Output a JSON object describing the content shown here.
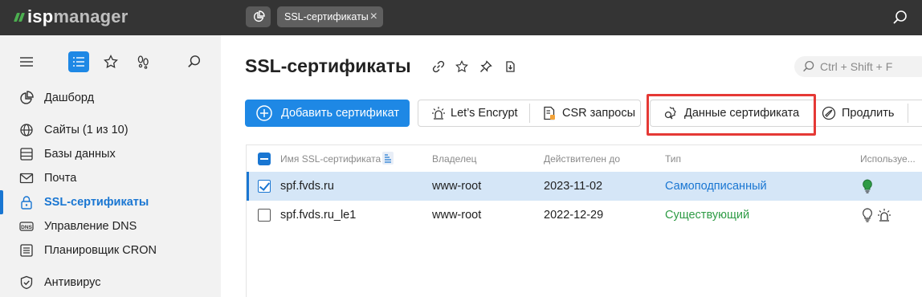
{
  "app": {
    "logo_text_main": "isp",
    "logo_text_rest": "manager"
  },
  "top_tab": {
    "label": "SSL-сертификаты",
    "close": "×"
  },
  "sidebar": {
    "items": [
      {
        "label": "Дашборд",
        "icon": "pie-chart-icon"
      },
      {
        "label": "Сайты (1 из 10)",
        "icon": "globe-icon"
      },
      {
        "label": "Базы данных",
        "icon": "database-icon"
      },
      {
        "label": "Почта",
        "icon": "mail-icon"
      },
      {
        "label": "SSL-сертификаты",
        "icon": "lock-icon",
        "active": true
      },
      {
        "label": "Управление DNS",
        "icon": "dns-icon"
      },
      {
        "label": "Планировщик CRON",
        "icon": "list-icon"
      },
      {
        "label": "Антивирус",
        "icon": "shield-icon"
      }
    ]
  },
  "page": {
    "title": "SSL-сертификаты",
    "search_placeholder": "Ctrl + Shift + F"
  },
  "toolbar": {
    "add": "Добавить сертификат",
    "letsencrypt": "Let’s Encrypt",
    "csr": "CSR запросы",
    "cert_data": "Данные сертификата",
    "renew": "Продлить"
  },
  "table": {
    "columns": [
      "Имя SSL-сертификата",
      "Владелец",
      "Действителен до",
      "Тип",
      "Используе..."
    ],
    "rows": [
      {
        "name": "spf.fvds.ru",
        "owner": "www-root",
        "valid_until": "2023-11-02",
        "type": "Самоподписанный",
        "selected": true
      },
      {
        "name": "spf.fvds.ru_le1",
        "owner": "www-root",
        "valid_until": "2022-12-29",
        "type": "Существующий",
        "selected": false
      }
    ]
  },
  "colors": {
    "accent": "#1976d2",
    "topbar": "#343434",
    "sidebar": "#f2f2f2",
    "highlight": "#e53935",
    "green": "#2e9b45"
  }
}
